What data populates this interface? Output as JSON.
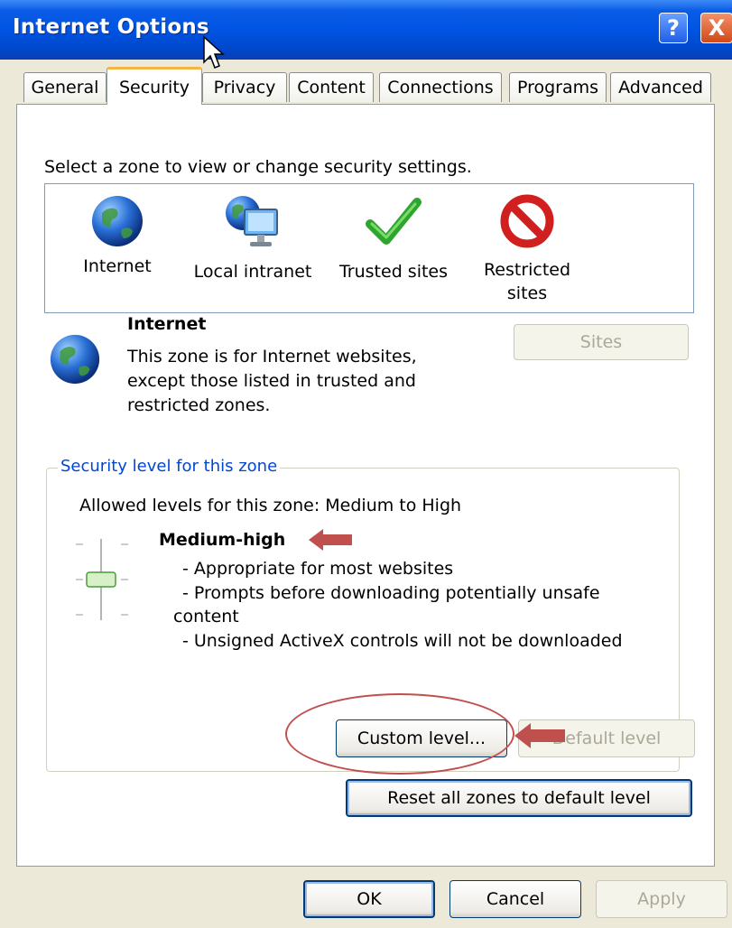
{
  "window": {
    "title": "Internet Options"
  },
  "titlebar": {
    "help_label": "?",
    "close_label": "X"
  },
  "tabs": [
    {
      "label": "General"
    },
    {
      "label": "Security"
    },
    {
      "label": "Privacy"
    },
    {
      "label": "Content"
    },
    {
      "label": "Connections"
    },
    {
      "label": "Programs"
    },
    {
      "label": "Advanced"
    }
  ],
  "active_tab": "Security",
  "security": {
    "instruction": "Select a zone to view or change security settings.",
    "zones": [
      {
        "label": "Internet",
        "icon": "globe-icon",
        "selected": true
      },
      {
        "label": "Local intranet",
        "icon": "intranet-globe-monitor-icon",
        "selected": false
      },
      {
        "label": "Trusted sites",
        "icon": "green-checkmark-icon",
        "selected": false
      },
      {
        "label_line1": "Restricted",
        "label_line2": "sites",
        "icon": "restricted-no-icon",
        "selected": false
      }
    ],
    "selected_zone": {
      "name": "Internet",
      "desc_line1": "This zone is for Internet websites,",
      "desc_line2": "except those listed in trusted and",
      "desc_line3": "restricted zones."
    },
    "sites_button": "Sites",
    "group": {
      "title": "Security level for this zone",
      "allowed": "Allowed levels for this zone: Medium to High",
      "level_name": "Medium-high",
      "bullet1": "- Appropriate for most websites",
      "bullet2a": "- Prompts before downloading potentially unsafe",
      "bullet2b": "content",
      "bullet3": "- Unsigned ActiveX controls will not be downloaded",
      "custom_level_button": "Custom level...",
      "default_level_button": "Default level"
    },
    "reset_button": "Reset all zones to default level"
  },
  "footer": {
    "ok": "OK",
    "cancel": "Cancel",
    "apply": "Apply"
  },
  "colors": {
    "titlebar": "#0054e3",
    "selection": "#316ac5",
    "annotation": "#c0504d",
    "group_title": "#0046d5"
  }
}
